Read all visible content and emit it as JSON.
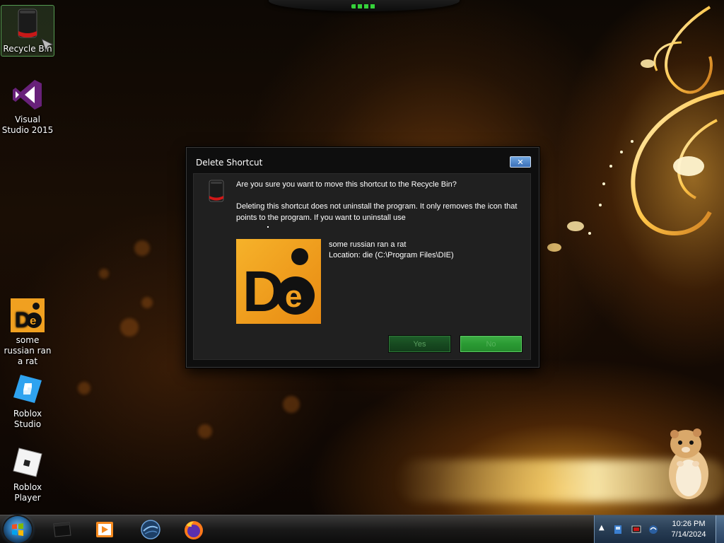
{
  "desktop_icons": [
    {
      "label": "Recycle Bin",
      "icon": "recycle-bin-icon"
    },
    {
      "label": "Visual Studio 2015",
      "icon": "visual-studio-icon"
    },
    {
      "label": "some russian ran a rat",
      "icon": "die-app-icon"
    },
    {
      "label": "Roblox Studio",
      "icon": "roblox-studio-icon"
    },
    {
      "label": "Roblox Player",
      "icon": "roblox-player-icon"
    }
  ],
  "dialog": {
    "title": "Delete Shortcut",
    "close_label": "✕",
    "question": "Are you sure you want to move this shortcut to the Recycle Bin?",
    "description": "Deleting this shortcut does not uninstall the program. It only removes the icon that points to the program. If you want to uninstall use",
    "item_name": "some russian ran a rat",
    "item_location": "Location: die (C:\\Program Files\\DIE)",
    "yes_label": "Yes",
    "no_label": "No",
    "app_icon_text": "De"
  },
  "taskbar": {
    "items": [
      "start-orb-icon",
      "terminal-window-icon",
      "media-player-icon",
      "globe-icon",
      "firefox-icon"
    ]
  },
  "tray": {
    "time": "10:26 PM",
    "date": "7/14/2024",
    "chevron": "▲"
  },
  "colors": {
    "dialog_bg": "#202020",
    "yes_button": "#1f5e2a",
    "no_button": "#3fae46",
    "accent_green": "#35d23a"
  }
}
